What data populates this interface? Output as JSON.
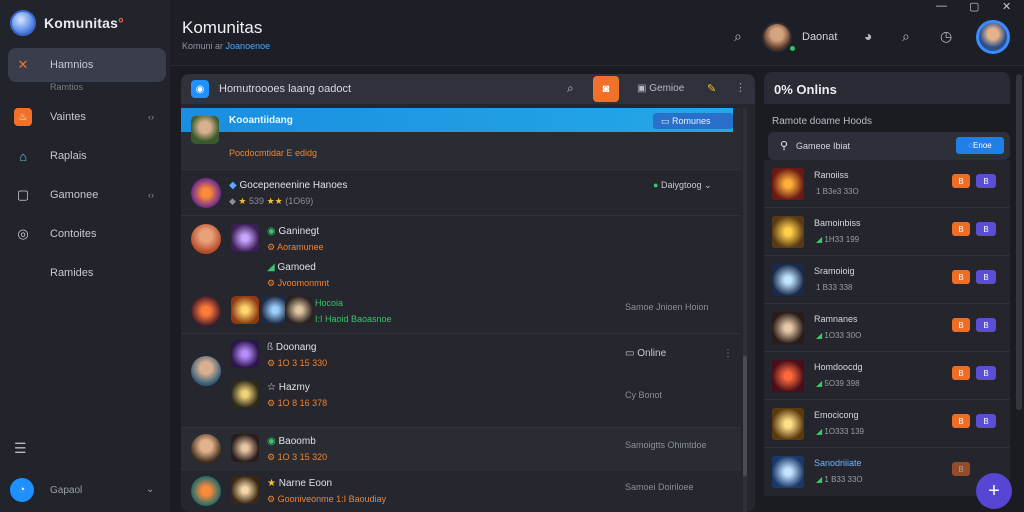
{
  "app": {
    "name": "Komunitas"
  },
  "sidebar": {
    "items": [
      {
        "label": "Hamnios",
        "sub": "Ramtios",
        "icon": "x-icon",
        "color": "#f0722a"
      },
      {
        "label": "Vaintes",
        "icon": "flame-icon",
        "color": "#f0722a"
      },
      {
        "label": "Raplais",
        "icon": "home-icon"
      },
      {
        "label": "Gamonee",
        "icon": "square-icon"
      },
      {
        "label": "Contoites",
        "icon": "target-icon"
      },
      {
        "label": "Ramides",
        "icon": ""
      }
    ],
    "footer_label": "Gapaol"
  },
  "header": {
    "title": "Komunitas",
    "subtitle_prefix": "Komuni ar",
    "subtitle_highlight": "Joanoenoe",
    "user_name": "Daonat"
  },
  "feed": {
    "search_text": "Homutroooes laang oadoct",
    "toolbar_label": "Gemioe",
    "banner": {
      "title": "Kooantiidang",
      "button": "Romunes"
    },
    "posts": [
      {
        "author": "Kooantiidang",
        "line": "Pocdocmtidar E edidg"
      },
      {
        "author": "Gocepeneenine Hanoes",
        "rating": "539",
        "rating_count": "(1O69)",
        "tag": "Daiygtoog"
      },
      {
        "author": "Ganinegt",
        "sub": "Aoramunee",
        "item2_title": "Gamoed",
        "item2_sub": "Jvoomonmnt",
        "green1": "Hocoia",
        "green2": "I:I Haoid Baoasnoe",
        "right_text": "Samoe Jnioen Hoion"
      },
      {
        "author": "Doonang",
        "sub": "1O 3 15 330",
        "item2_title": "Hazmy",
        "item2_sub": "1O 8 16 378",
        "status": "Online",
        "right_text": "Cy Bonot"
      },
      {
        "author": "Baoomb",
        "sub": "1O 3 15 320",
        "right_text": "Samoigtts Ohimtdoe"
      },
      {
        "author": "Narne Eoon",
        "sub": "Gooniveonme 1:I Baoudiay",
        "right_text": "Samoei Doiriloee"
      }
    ]
  },
  "online": {
    "title": "Onlins",
    "section_label": "Ramote doame Hoods",
    "search_text": "Gameoe Ibiat",
    "search_button": "Enoe",
    "rows": [
      {
        "name": "Ranoiiss",
        "meta": "1 B3e3 33O",
        "b1": "B",
        "b2": "B"
      },
      {
        "name": "Bamoinbiss",
        "meta": "1H33 199",
        "b1": "B",
        "b2": "B"
      },
      {
        "name": "Sramoioig",
        "meta": "1 B33 338",
        "b1": "B",
        "b2": "B"
      },
      {
        "name": "Ramnanes",
        "meta": "1O33 30O",
        "b1": "B",
        "b2": "B"
      },
      {
        "name": "Homdoocdg",
        "meta": "5O39 398",
        "b1": "B",
        "b2": "B"
      },
      {
        "name": "Emocicong",
        "meta": "1O333 139",
        "b1": "B",
        "b2": "B"
      },
      {
        "name": "Sanodriiiate",
        "meta": "1 B33 33O",
        "b1": "B",
        "b2": "B"
      }
    ]
  }
}
